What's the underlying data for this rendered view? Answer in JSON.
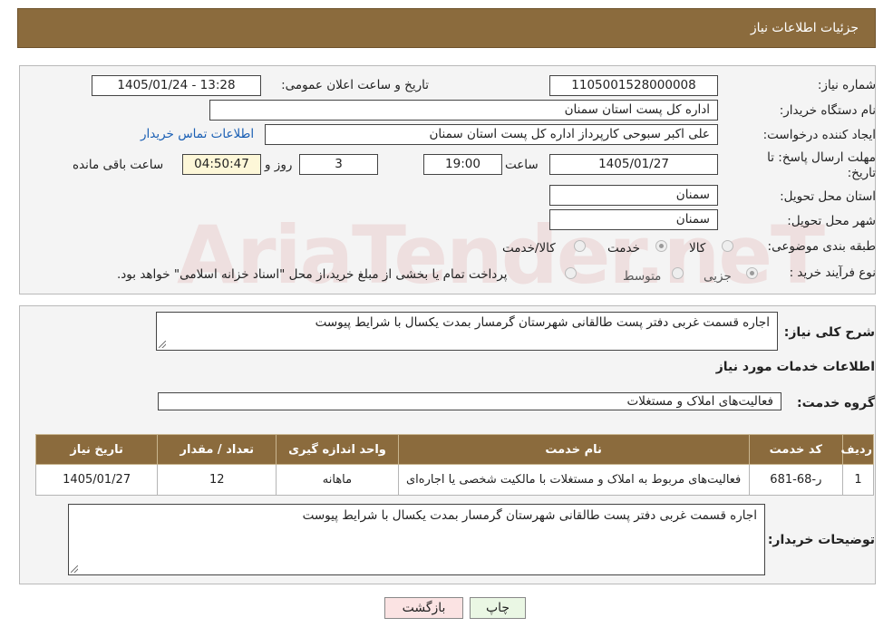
{
  "header": {
    "title": "جزئیات اطلاعات نیاز"
  },
  "watermark": "AriaTender.neT",
  "fields": {
    "need_number_label": "شماره نیاز:",
    "need_number": "1105001528000008",
    "announce_label": "تاریخ و ساعت اعلان عمومی:",
    "announce_value": "1405/01/24 - 13:28",
    "buyer_org_label": "نام دستگاه خریدار:",
    "buyer_org": "اداره کل پست استان سمنان",
    "creator_label": "ایجاد کننده درخواست:",
    "creator": "علی اکبر سبوحی کارپرداز اداره کل پست استان سمنان",
    "contact_link": "اطلاعات تماس خریدار",
    "deadline_label": "مهلت ارسال پاسخ: تا تاریخ:",
    "deadline_date": "1405/01/27",
    "time_label": "ساعت",
    "deadline_time": "19:00",
    "days": "3",
    "days_label": "روز و",
    "remaining": "04:50:47",
    "remaining_label": "ساعت باقی مانده",
    "province_label": "استان محل تحویل:",
    "province": "سمنان",
    "city_label": "شهر محل تحویل:",
    "city": "سمنان",
    "category_label": "طبقه بندی موضوعی:",
    "category_options": [
      "کالا",
      "خدمت",
      "کالا/خدمت"
    ],
    "category_selected": "خدمت",
    "purchase_type_label": "نوع فرآیند خرید :",
    "purchase_options": [
      "جزیی",
      "متوسط"
    ],
    "purchase_note": "پرداخت تمام یا بخشی از مبلغ خرید،از محل \"اسناد خزانه اسلامی\" خواهد بود."
  },
  "summary": {
    "label": "شرح کلی نیاز:",
    "value": "اجاره قسمت غربی دفتر پست طالقانی شهرستان گرمسار بمدت یکسال با شرایط پیوست"
  },
  "services": {
    "section_title": "اطلاعات خدمات مورد نیاز",
    "group_label": "گروه خدمت:",
    "group_value": "فعالیت‌های  املاک و مستغلات",
    "columns": [
      "ردیف",
      "کد خدمت",
      "نام خدمت",
      "واحد اندازه گیری",
      "تعداد / مقدار",
      "تاریخ نیاز"
    ],
    "rows": [
      [
        "1",
        "ر-68-681",
        "فعالیت‌های مربوط به املاک و مستغلات با مالکیت شخصی یا اجاره‌ای",
        "ماهانه",
        "12",
        "1405/01/27"
      ]
    ]
  },
  "buyer_notes": {
    "label": "توضیحات خریدار:",
    "value": "اجاره قسمت غربی دفتر پست طالقانی شهرستان گرمسار بمدت یکسال با شرایط پیوست"
  },
  "buttons": {
    "print": "چاپ",
    "back": "بازگشت"
  },
  "colors": {
    "header_bg": "#8b6b3d",
    "print_bg": "#eaf7e4",
    "back_bg": "#fbe3e3"
  }
}
